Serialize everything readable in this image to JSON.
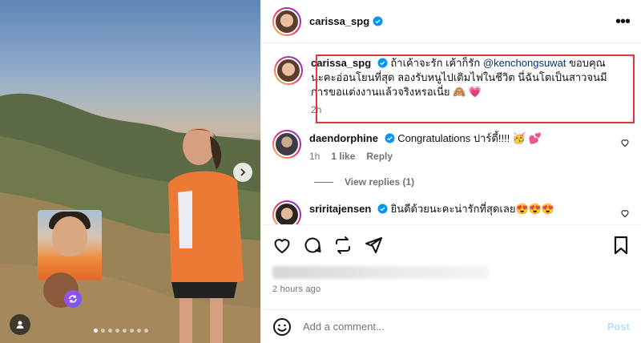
{
  "post": {
    "image_alt": "",
    "carousel": {
      "count": 8,
      "active_index": 0
    }
  },
  "header": {
    "username": "carissa_spg",
    "verified": true
  },
  "caption": {
    "username": "carissa_spg",
    "text_before": "ถ้าเค้าจะรัก เค้าก็รัก ",
    "mention": "@kenchongsuwat",
    "text_after": " ขอบคุณนะคะอ่อนโยนที่สุด ลองรับหนูไปเติมไฟในชีวิต นี่ฉันโตเป็นสาวจนมีการขอแต่งงานแล้วจริงหรอเนี่ย 🙈 💗",
    "time": "2h"
  },
  "comments": [
    {
      "username": "daendorphine",
      "verified": true,
      "text": "Congratulations ปาร์ตี้!!!! 🥳 💕",
      "time": "1h",
      "likes": "1 like",
      "reply_label": "Reply",
      "view_replies": "View replies (1)"
    },
    {
      "username": "sriritajensen",
      "verified": true,
      "text": "ยินดีด้วยนะคะน่ารักที่สุดเลย😍😍😍"
    }
  ],
  "icons": {
    "like": "heart-icon",
    "comment": "comment-icon",
    "share": "repost-icon",
    "send": "send-icon",
    "save": "bookmark-icon",
    "emoji": "emoji-icon",
    "more": "more-icon"
  },
  "footer": {
    "time_ago": "2 hours ago",
    "comment_placeholder": "Add a comment...",
    "post_label": "Post"
  },
  "colors": {
    "verified": "#0095f6",
    "mention": "#00376b",
    "highlight_border": "#e0373a",
    "post_disabled": "#b2dffc"
  }
}
